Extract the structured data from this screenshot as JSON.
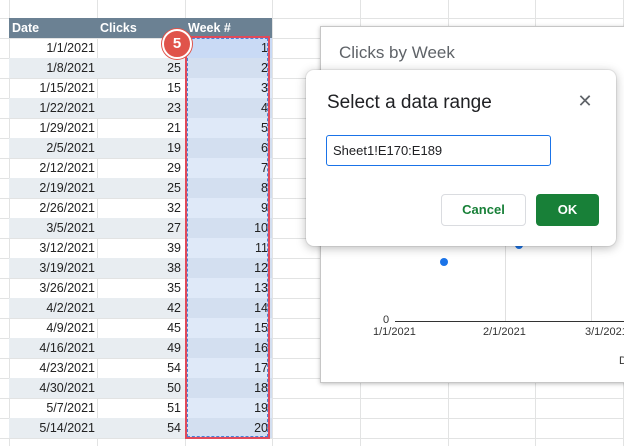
{
  "sheet": {
    "headers": {
      "date": "Date",
      "clicks": "Clicks",
      "week": "Week #"
    },
    "rows": [
      {
        "date": "1/1/2021",
        "clicks": "",
        "week": "1"
      },
      {
        "date": "1/8/2021",
        "clicks": "25",
        "week": "2"
      },
      {
        "date": "1/15/2021",
        "clicks": "15",
        "week": "3"
      },
      {
        "date": "1/22/2021",
        "clicks": "23",
        "week": "4"
      },
      {
        "date": "1/29/2021",
        "clicks": "21",
        "week": "5"
      },
      {
        "date": "2/5/2021",
        "clicks": "19",
        "week": "6"
      },
      {
        "date": "2/12/2021",
        "clicks": "29",
        "week": "7"
      },
      {
        "date": "2/19/2021",
        "clicks": "25",
        "week": "8"
      },
      {
        "date": "2/26/2021",
        "clicks": "32",
        "week": "9"
      },
      {
        "date": "3/5/2021",
        "clicks": "27",
        "week": "10"
      },
      {
        "date": "3/12/2021",
        "clicks": "39",
        "week": "11"
      },
      {
        "date": "3/19/2021",
        "clicks": "38",
        "week": "12"
      },
      {
        "date": "3/26/2021",
        "clicks": "35",
        "week": "13"
      },
      {
        "date": "4/2/2021",
        "clicks": "42",
        "week": "14"
      },
      {
        "date": "4/9/2021",
        "clicks": "45",
        "week": "15"
      },
      {
        "date": "4/16/2021",
        "clicks": "49",
        "week": "16"
      },
      {
        "date": "4/23/2021",
        "clicks": "54",
        "week": "17"
      },
      {
        "date": "4/30/2021",
        "clicks": "50",
        "week": "18"
      },
      {
        "date": "5/7/2021",
        "clicks": "51",
        "week": "19"
      },
      {
        "date": "5/14/2021",
        "clicks": "54",
        "week": "20"
      }
    ]
  },
  "step_badge": "5",
  "chart": {
    "title": "Clicks by Week",
    "y_zero_label": "0",
    "x_ticks": [
      "1/1/2021",
      "2/1/2021",
      "3/1/2021"
    ],
    "cut_label": "D"
  },
  "dialog": {
    "title": "Select a data range",
    "close_icon": "close-icon",
    "range_value": "Sheet1!E170:E189",
    "cancel_label": "Cancel",
    "ok_label": "OK"
  },
  "colors": {
    "header_bg": "#6b8193",
    "alt_row_bg": "#e8edf1",
    "selection_outline": "#e04a5a",
    "badge": "#e0534a",
    "accent_blue": "#1a73e8",
    "ok_green": "#188038"
  }
}
